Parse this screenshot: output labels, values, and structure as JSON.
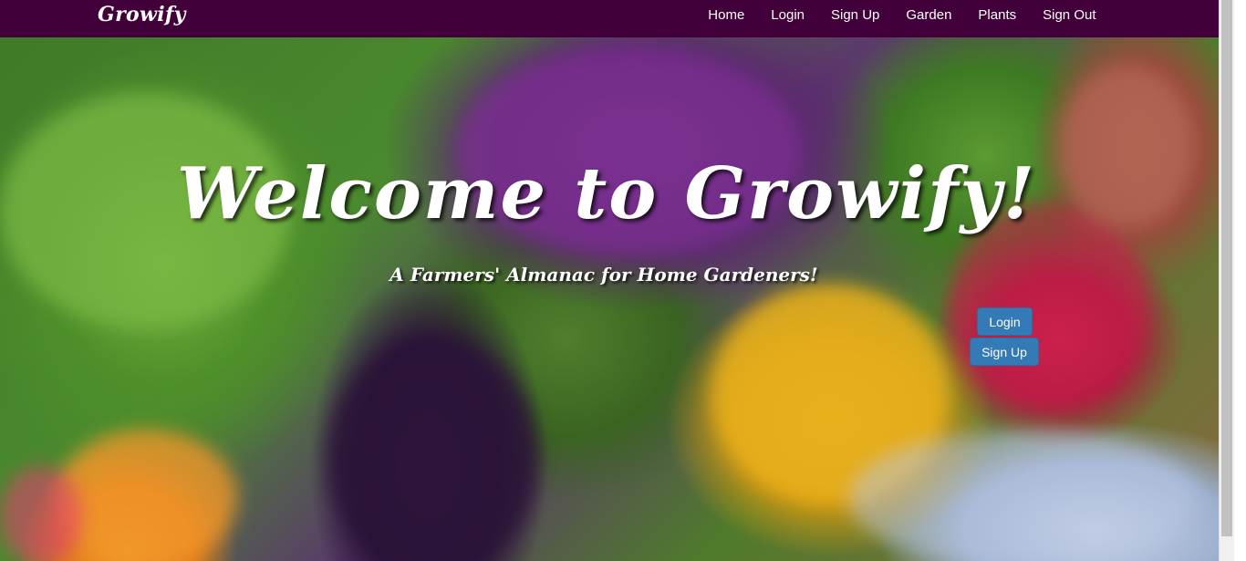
{
  "navbar": {
    "brand": "Growify",
    "links": [
      "Home",
      "Login",
      "Sign Up",
      "Garden",
      "Plants",
      "Sign Out"
    ]
  },
  "hero": {
    "title": "Welcome to Growify!",
    "subtitle": "A Farmers' Almanac for Home Gardeners!",
    "login_button": "Login",
    "signup_button": "Sign Up"
  },
  "colors": {
    "navbar_bg": "#42003a",
    "button_bg": "#337ab7",
    "text": "#ffffff"
  }
}
